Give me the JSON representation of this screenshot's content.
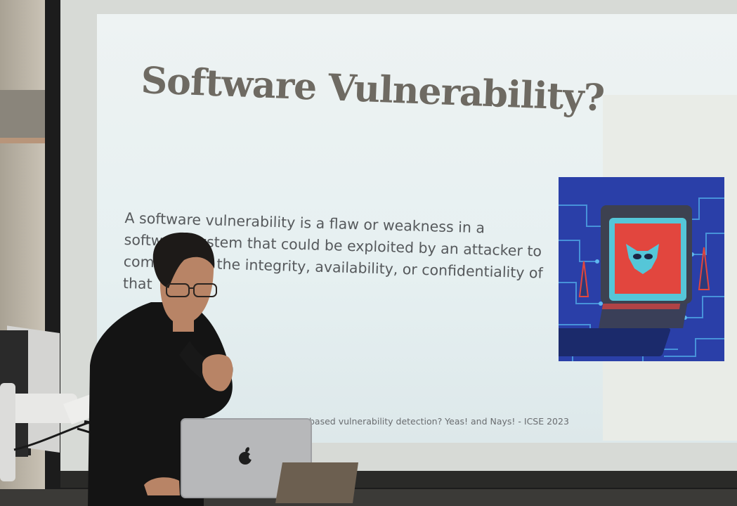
{
  "slide": {
    "title": "Software Vulnerability?",
    "body_lines": [
      "A software vulnerability is a flaw or weakness in a",
      "software system that could be exploited by an attacker to",
      "compromise the integrity, availability, or confidentiality of",
      "that"
    ],
    "footer": "based vulnerability detection? Yeas! and Nays! - ICSE 2023"
  },
  "illustration": {
    "icon": "devil-mask-laptop-icon",
    "colors": {
      "background": "#2a3fa8",
      "circuit": "#4fa7e6",
      "screen": "#e2463e",
      "mask": "#55c6d8"
    }
  },
  "scene": {
    "laptop_logo_icon": "apple-logo-icon",
    "colors": {
      "shirt": "#141414",
      "hair": "#1d1a18",
      "skin": "#b88466",
      "laptop": "#b7b8ba",
      "arm": "#e6e6e6"
    }
  }
}
